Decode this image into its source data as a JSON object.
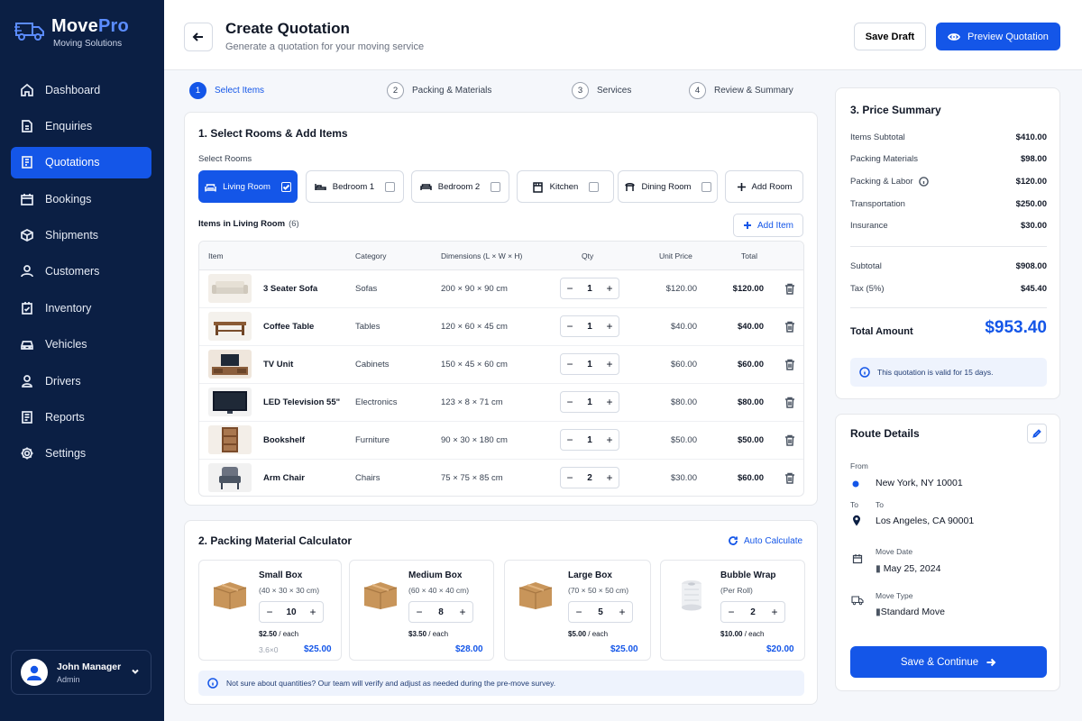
{
  "brand": {
    "name_main": "Move",
    "name_accent": "Pro",
    "tagline": "Moving Solutions"
  },
  "nav": [
    {
      "label": "Dashboard",
      "icon": "home-icon",
      "active": false
    },
    {
      "label": "Enquiries",
      "icon": "document-icon",
      "active": false
    },
    {
      "label": "Quotations",
      "icon": "quotation-icon",
      "active": true
    },
    {
      "label": "Bookings",
      "icon": "calendar-icon",
      "active": false
    },
    {
      "label": "Shipments",
      "icon": "box-icon",
      "active": false
    },
    {
      "label": "Customers",
      "icon": "user-icon",
      "active": false
    },
    {
      "label": "Inventory",
      "icon": "checklist-icon",
      "active": false
    },
    {
      "label": "Vehicles",
      "icon": "car-icon",
      "active": false
    },
    {
      "label": "Drivers",
      "icon": "driver-icon",
      "active": false
    },
    {
      "label": "Reports",
      "icon": "report-icon",
      "active": false
    },
    {
      "label": "Settings",
      "icon": "gear-icon",
      "active": false
    }
  ],
  "user": {
    "name": "John Manager",
    "role": "Admin"
  },
  "header": {
    "title": "Create Quotation",
    "subtitle": "Generate a quotation for your moving service",
    "save_draft": "Save Draft",
    "preview": "Preview Quotation"
  },
  "steps": [
    {
      "num": "1",
      "label": "Select Items"
    },
    {
      "num": "2",
      "label": "Packing & Materials"
    },
    {
      "num": "3",
      "label": "Services"
    },
    {
      "num": "4",
      "label": "Review & Summary"
    }
  ],
  "rooms_section": {
    "title": "1.  Select Rooms & Add Items",
    "select_label": "Select Rooms",
    "rooms": [
      "Living Room",
      "Bedroom 1",
      "Bedroom 2",
      "Kitchen",
      "Dining Room"
    ],
    "add_room": "Add Room",
    "items_label": "Items in Living Room",
    "items_count": "(6)",
    "add_item": "Add Item"
  },
  "table": {
    "headers": [
      "Item",
      "Category",
      "Dimensions (L × W × H)",
      "Qty",
      "Unit Price",
      "Total"
    ],
    "rows": [
      {
        "name": "3 Seater Sofa",
        "category": "Sofas",
        "dims": "200 × 90 × 90 cm",
        "qty": "1",
        "price": "$120.00",
        "total": "$120.00"
      },
      {
        "name": "Coffee Table",
        "category": "Tables",
        "dims": "120 × 60 × 45 cm",
        "qty": "1",
        "price": "$40.00",
        "total": "$40.00"
      },
      {
        "name": "TV Unit",
        "category": "Cabinets",
        "dims": "150 × 45 × 60 cm",
        "qty": "1",
        "price": "$60.00",
        "total": "$60.00"
      },
      {
        "name": "LED Television 55\"",
        "category": "Electronics",
        "dims": "123 × 8 × 71 cm",
        "qty": "1",
        "price": "$80.00",
        "total": "$80.00"
      },
      {
        "name": "Bookshelf",
        "category": "Furniture",
        "dims": "90 × 30 × 180 cm",
        "qty": "1",
        "price": "$50.00",
        "total": "$50.00"
      },
      {
        "name": "Arm Chair",
        "category": "Chairs",
        "dims": "75 × 75 × 85 cm",
        "qty": "2",
        "price": "$30.00",
        "total": "$60.00"
      }
    ]
  },
  "packing": {
    "title": "2.  Packing Material Calculator",
    "auto_calc": "Auto Calculate",
    "items": [
      {
        "name": "Small Box",
        "dims": "(40 × 30 × 30 cm)",
        "qty": "10",
        "each": "$2.50",
        "each_suffix": " / each",
        "total": "$25.00",
        "faint": "3.6×0"
      },
      {
        "name": "Medium Box",
        "dims": "(60 × 40 × 40 cm)",
        "qty": "8",
        "each": "$3.50",
        "each_suffix": " / each",
        "total": "$28.00"
      },
      {
        "name": "Large Box",
        "dims": "(70 × 50 × 50 cm)",
        "qty": "5",
        "each": "$5.00",
        "each_suffix": " / each",
        "total": "$25.00"
      },
      {
        "name": "Bubble Wrap",
        "dims": "(Per Roll)",
        "qty": "2",
        "each": "$10.00",
        "each_suffix": " / each",
        "total": "$20.00"
      }
    ],
    "note": "Not sure about quantities? Our team will verify and adjust as needed during the pre-move survey."
  },
  "price_summary": {
    "title": "3.  Price Summary",
    "rows": [
      {
        "label": "Items Subtotal",
        "value": "$410.00"
      },
      {
        "label": "Packing Materials",
        "value": "$98.00"
      },
      {
        "label": "Packing & Labor",
        "value": "$120.00"
      },
      {
        "label": "Transportation",
        "value": "$250.00"
      },
      {
        "label": "Insurance",
        "value": "$30.00"
      }
    ],
    "subtotal_label": "Subtotal",
    "subtotal": "$908.00",
    "tax_label": "Tax (5%)",
    "tax": "$45.40",
    "total_label": "Total Amount",
    "total": "$953.40",
    "validity": "This quotation is valid for 15 days."
  },
  "route": {
    "title": "Route Details",
    "from_label": "From",
    "from": "New York, NY 10001",
    "to_label_left": "To",
    "to_label": "To",
    "to": "Los Angeles, CA 90001",
    "date_label": "Move Date",
    "date": "May 25, 2024",
    "type_label": "Move Type",
    "type": "Standard Move",
    "save_continue": "Save & Continue"
  },
  "colors": {
    "sidebar": "#0b1f44",
    "accent": "#1456e8",
    "background": "#f5f7fb"
  }
}
